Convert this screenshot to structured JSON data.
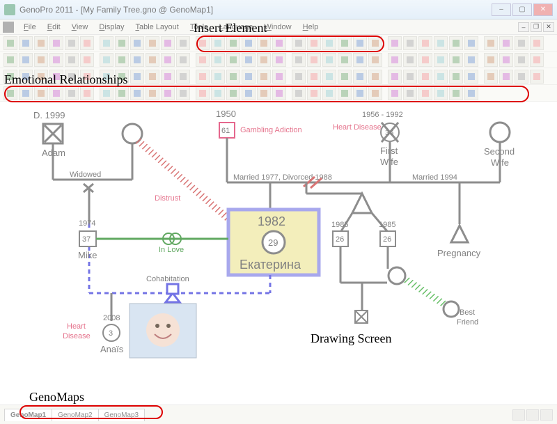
{
  "window": {
    "title": "GenoPro 2011 - [My Family Tree.gno @ GenoMap1]"
  },
  "menu": {
    "items": [
      "File",
      "Edit",
      "View",
      "Display",
      "Table Layout",
      "Tools",
      "Language",
      "Window",
      "Help"
    ]
  },
  "tabs": {
    "items": [
      "GenoMap1",
      "GenoMap2",
      "GenoMap3"
    ],
    "active": 0
  },
  "annotations": {
    "insert": "Insert Element",
    "emotional": "Emotional Relationships",
    "drawing": "Drawing Screen",
    "genomaps": "GenoMaps"
  },
  "tree": {
    "adam": {
      "name": "Adam",
      "death": "D. 1999"
    },
    "widowed": "Widowed",
    "distrust": "Distrust",
    "mom_year": "1950",
    "mom_age": "61",
    "mom_annot": "Gambling Adiction",
    "married1": "Married 1977, Divorced 1988",
    "mike": {
      "name": "Mike",
      "year": "1974",
      "age": "37"
    },
    "inlove": "In Love",
    "cohab": "Cohabitation",
    "kat": {
      "name": "Екатерина",
      "year": "1982",
      "age": "29"
    },
    "anais": {
      "name": "Anaïs",
      "year": "2008",
      "age": "3",
      "annot": "Heart Disease"
    },
    "fw": {
      "label": "First\nWife",
      "year": "1956 - 1992",
      "age": "36",
      "annot": "Heart Disease"
    },
    "sw": {
      "label": "Second\nWife"
    },
    "married2": "Married 1994",
    "twin_a": {
      "year": "1985",
      "age": "26"
    },
    "twin_b": {
      "year": "1985",
      "age": "26"
    },
    "preg": "Pregnancy",
    "bf": "Best\nFriend"
  }
}
